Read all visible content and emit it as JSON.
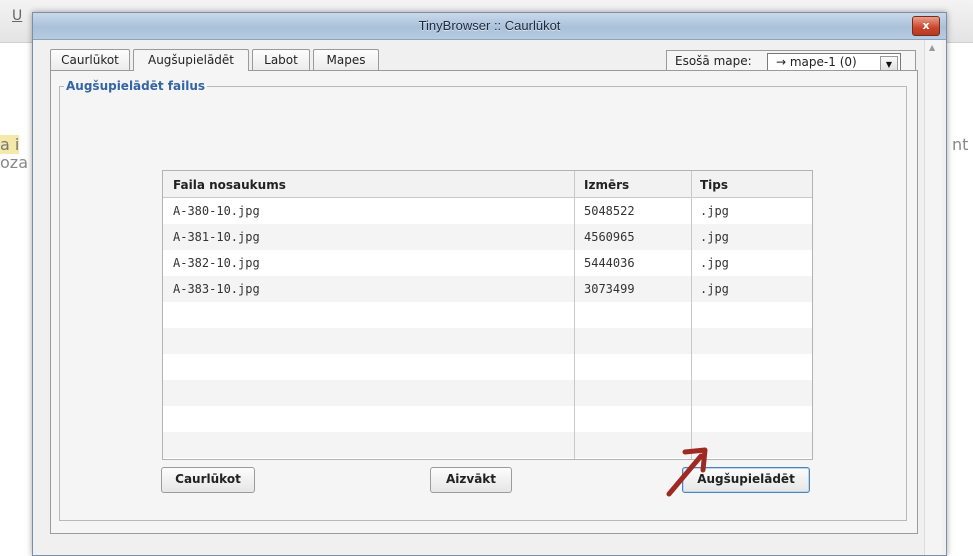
{
  "window": {
    "title": "TinyBrowser :: Caurlūkot",
    "close_label": "x"
  },
  "background": {
    "fragment_left": "a i",
    "fragment_left2": "oza",
    "fragment_right": "nt",
    "toolbar_letter": "U"
  },
  "tabs": [
    {
      "label": "Caurlūkot"
    },
    {
      "label": "Augšupielādēt",
      "active": true
    },
    {
      "label": "Labot"
    },
    {
      "label": "Mapes"
    }
  ],
  "folder": {
    "label": "Esošā mape:",
    "selected": "→ mape-1 (0)"
  },
  "upload": {
    "legend": "Augšupielādēt failus",
    "columns": [
      "Faila nosaukums",
      "Izmērs",
      "Tips"
    ],
    "rows": [
      {
        "name": "A-380-10.jpg",
        "size": "5048522",
        "type": ".jpg"
      },
      {
        "name": "A-381-10.jpg",
        "size": "4560965",
        "type": ".jpg"
      },
      {
        "name": "A-382-10.jpg",
        "size": "5444036",
        "type": ".jpg"
      },
      {
        "name": "A-383-10.jpg",
        "size": "3073499",
        "type": ".jpg"
      }
    ]
  },
  "buttons": {
    "browse": "Caurlūkot",
    "remove": "Aizvākt",
    "upload": "Augšupielādēt"
  },
  "colors": {
    "legend": "#3465a4",
    "annotation_arrow": "#9e2a23",
    "focus_border": "#4d83b8"
  },
  "icons": {
    "close": "close-icon",
    "dropdown": "chevron-down-icon",
    "annotation": "arrow-icon"
  }
}
